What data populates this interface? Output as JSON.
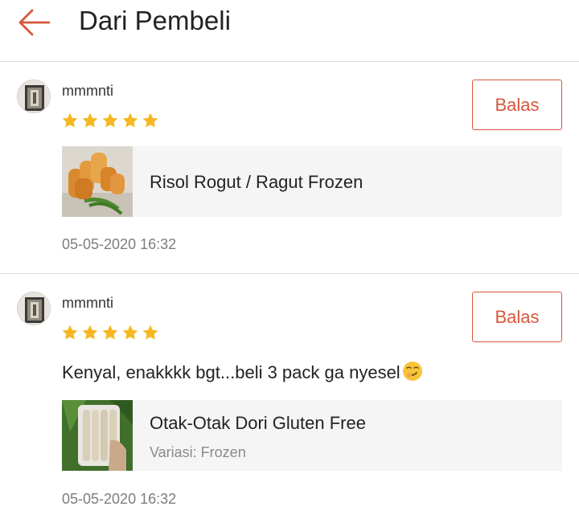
{
  "header": {
    "back_icon": "arrow-left-icon",
    "title": "Dari Pembeli"
  },
  "colors": {
    "accent": "#d6573b",
    "star": "#f6b822",
    "divider": "#dcdcdc",
    "product_bg": "#f5f5f5",
    "muted_text": "#7d7d7d"
  },
  "reviews": [
    {
      "username": "mmmnti",
      "avatar_icon": "user-avatar",
      "rating": 5,
      "reply_label": "Balas",
      "comment": "",
      "product": {
        "name": "Risol Rogut / Ragut Frozen",
        "variant": "",
        "thumbnail_icon": "risol-photo"
      },
      "timestamp": "05-05-2020 16:32"
    },
    {
      "username": "mmmnti",
      "avatar_icon": "user-avatar",
      "rating": 5,
      "reply_label": "Balas",
      "comment": "Kenyal, enakkkk bgt...beli 3 pack ga nyesel",
      "comment_emoji": "smirk-face-emoji",
      "product": {
        "name": "Otak-Otak Dori Gluten Free",
        "variant": "Variasi: Frozen",
        "thumbnail_icon": "otak-otak-photo"
      },
      "timestamp": "05-05-2020 16:32"
    }
  ]
}
